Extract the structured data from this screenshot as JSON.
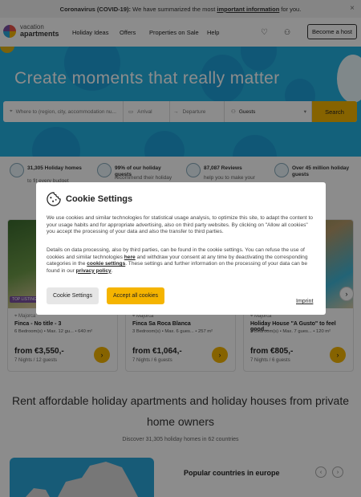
{
  "banner": {
    "bold": "Coronavirus (COVID-19):",
    "text": "We have summarized the most",
    "link": "important information",
    "tail": "for you.",
    "close": "×"
  },
  "header": {
    "logo_line1": "vacation",
    "logo_line2": "apartments",
    "nav": [
      "Holiday Ideas",
      "Offers",
      "Properties on Sale",
      "Help"
    ],
    "favorites_icon": "heart-icon",
    "account_icon": "user-icon",
    "cta": "Become a host"
  },
  "hero": {
    "headline": "Create moments that really matter",
    "search": {
      "destination_placeholder": "Where to (region, city, accommodation nu...",
      "arrival": "Arrival",
      "departure": "Departure",
      "guests": "Guests",
      "button": "Search"
    }
  },
  "features": [
    {
      "title": "31,305 Holiday homes",
      "sub": "to fit every budget"
    },
    {
      "title": "99% of our holiday guests",
      "sub": "recommend their holiday"
    },
    {
      "title": "87,087 Reviews",
      "sub": "help you to make your"
    },
    {
      "title": "Over 45 million holiday guests",
      "sub": "trust us"
    }
  ],
  "cards": [
    {
      "tag": "TOP LISTING",
      "location": "Majorca",
      "title": "Finca - No title - 3",
      "meta": "6 Bedroom(s) • Max. 12 gu... • 640 m²",
      "price": "from €3,550,-",
      "nights": "7 Nights / 12 guests"
    },
    {
      "tag": "",
      "location": "Majorca",
      "title": "Finca Sa Roca Blanca",
      "meta": "3 Bedroom(s) • Max. 6 gues... • 257 m²",
      "price": "from €1,064,-",
      "nights": "7 Nights / 6 guests"
    },
    {
      "tag": "",
      "location": "Majorca",
      "title": "Holiday House \"A Gusto\" to feel good...",
      "meta": "3 Bedroom(s) • Max. 7 gues... • 120 m²",
      "price": "from €805,-",
      "nights": "7 Nights / 6 guests"
    }
  ],
  "section": {
    "heading_line1": "Rent affordable holiday apartments and holiday houses from private",
    "heading_line2": "home owners",
    "discover": "Discover 31,305 holiday homes in 62 countries",
    "popular": "Popular countries in europe"
  },
  "cookie_modal": {
    "title": "Cookie Settings",
    "p1": "We use cookies and similar technologies for statistical usage analysis, to optimize this site, to adapt the content to your usage habits and for appropriate advertising, also on third party websites. By clicking on \"Allow all cookies\" you accept the processing of your data and also the transfer to third parties.",
    "p2a": "Details on data processing, also by third parties, can be found in the cookie settings. You can refuse the use of cookies and similar technologies",
    "p2_link1": "here",
    "p2b": "and withdraw your consent at any time by deactivating the corresponding categories in the",
    "p2_link2": "cookie settings",
    "p2c": ". These settings and further information on the processing of your data can be found in our",
    "p2_link3": "privacy policy",
    "p2d": ".",
    "btn_settings": "Cookie Settings",
    "btn_accept": "Accept all cookies",
    "imprint": "Imprint"
  },
  "colors": {
    "accent": "#f5b400",
    "hero": "#24b1e0"
  }
}
